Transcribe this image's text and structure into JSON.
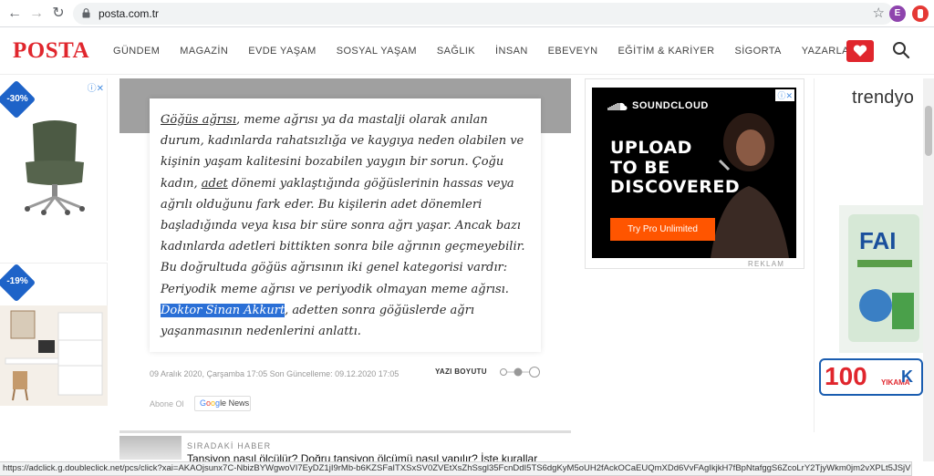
{
  "browser": {
    "url": "posta.com.tr",
    "profile_initial": "E"
  },
  "site": {
    "logo": "POSTA",
    "nav": [
      "GÜNDEM",
      "MAGAZİN",
      "EVDE YAŞAM",
      "SOSYAL YAŞAM",
      "SAĞLIK",
      "İNSAN",
      "EBEVEYN",
      "EĞİTİM & KARİYER",
      "SİGORTA",
      "YAZARLAR"
    ]
  },
  "left_ads": {
    "badge_1": "-30%",
    "badge_2": "-19%"
  },
  "article": {
    "p1_link": "Göğüs ağrısı",
    "p1": ", meme ağrısı ya da mastalji olarak anılan durum, kadınlarda rahatsızlığa ve kaygıya neden olabilen ve kişinin yaşam kalitesini bozabilen yaygın bir sorun. Çoğu kadın, ",
    "p2_link": "adet",
    "p2": " dönemi yaklaştığında göğüslerinin hassas veya ağrılı olduğunu fark eder. Bu kişilerin adet dönemleri başladığında veya kısa bir süre sonra ağrı yaşar. Ancak bazı kadınlarda adetleri bittikten sonra bile ağrının geçmeyebilir. Bu doğrultuda göğüs ağrısının iki genel kategorisi vardır: Periyodik meme ağrısı ve periyodik olmayan meme ağrısı. ",
    "highlight": "Doktor Sinan Akkurt",
    "p3": ", adetten sonra göğüslerde ağrı yaşanmasının nedenlerini anlattı.",
    "date": "09 Aralık 2020, Çarşamba 17:05",
    "updated_label": "Son Güncelleme:",
    "updated_date": "09.12.2020 17:05",
    "font_size_label": "YAZI BOYUTU",
    "subscribe": "Abone Ol",
    "google_news": [
      "G",
      "o",
      "o",
      "g",
      "le News"
    ]
  },
  "next": {
    "label": "SIRADAKİ HABER",
    "title": "Tansiyon nasıl ölçülür? Doğru tansiyon ölçümü nasıl yapılır? İşte kurallar"
  },
  "sc_ad": {
    "brand": "SOUNDCLOUD",
    "headline_1": "UPLOAD",
    "headline_2": "TO BE",
    "headline_3": "DISCOVERED",
    "button": "Try Pro Unlimited",
    "reklam": "REKLAM"
  },
  "right_ad": {
    "brand": "trendyo",
    "price": "100",
    "unit": "YIKAMA",
    "suffix": "K"
  },
  "status_url": "https://adclick.g.doubleclick.net/pcs/click?xai=AKAOjsunx7C-NbizBYWgwoVI7EyDZ1jI9rMb-b6KZSFaITXSxSV0ZVEtXsZhSsgl35FcnDdI5TS6dgKyM5oUH2fAckOCaEUQmXDd6VvFAgIkjkH7fBpNtafggS6ZcoLrY2TjyWkm0jm2vXPLt5JSjVMGDgY1xRcCS4f..."
}
